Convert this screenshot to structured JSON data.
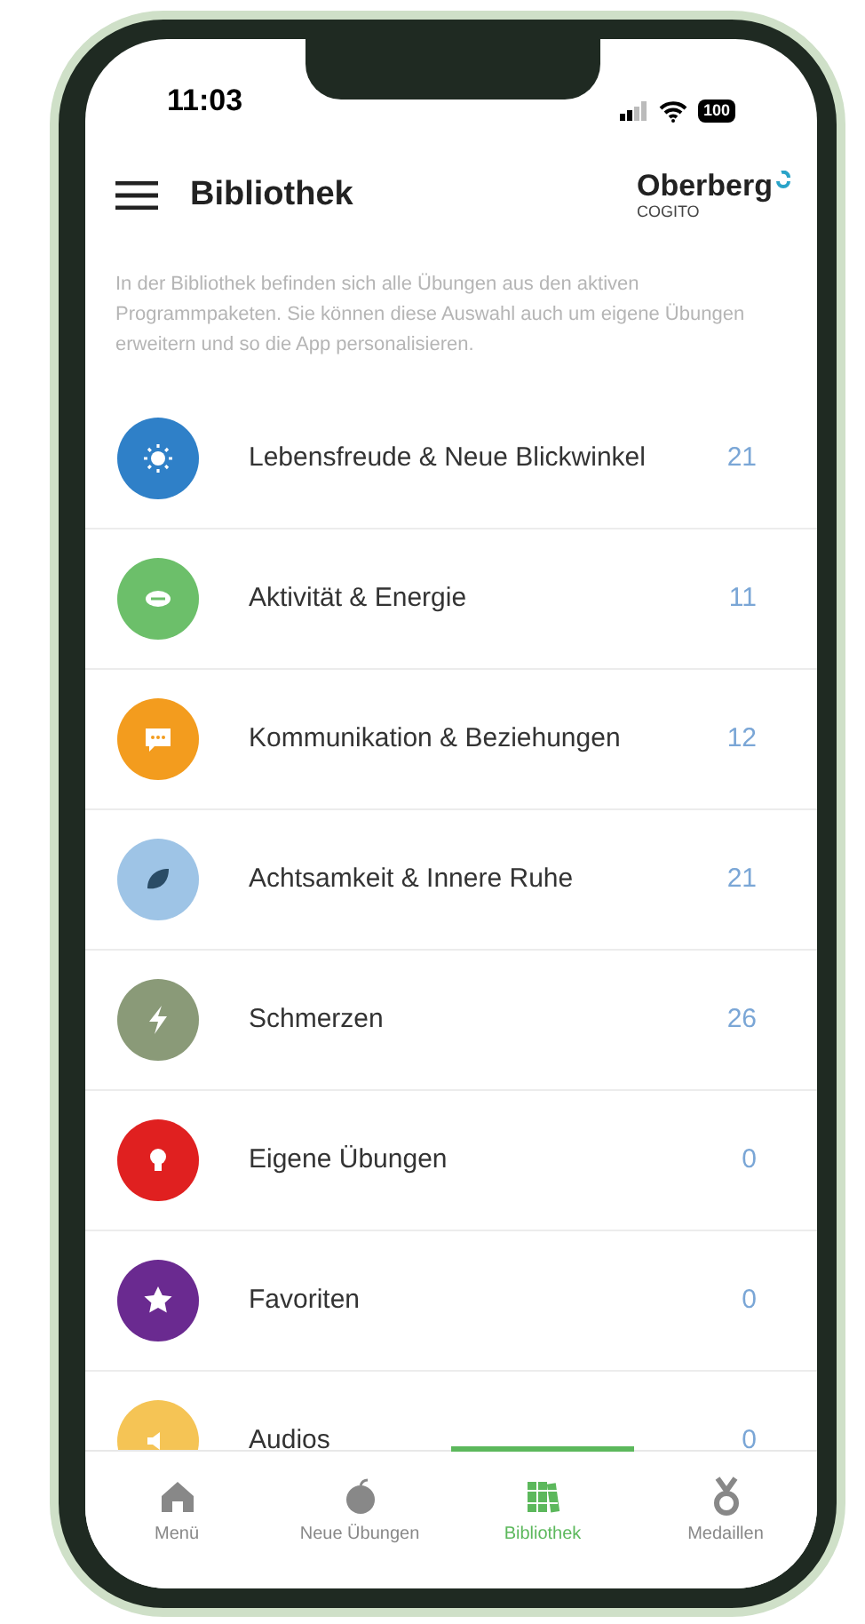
{
  "status_bar": {
    "time": "11:03",
    "battery": "100"
  },
  "header": {
    "title": "Bibliothek",
    "logo": "Oberberg",
    "logo_sub": "COGITO"
  },
  "intro": "In der Bibliothek befinden sich alle Übungen aus den aktiven Programmpaketen. Sie können diese Auswahl auch um eigene Übungen erweitern und so die App personalisieren.",
  "categories": [
    {
      "label": "Lebensfreude & Neue Blickwinkel",
      "count": "21",
      "color": "#2f80c8",
      "kind": "sun"
    },
    {
      "label": "Aktivität & Energie",
      "count": "11",
      "color": "#6cbf6a",
      "kind": "ball"
    },
    {
      "label": "Kommunikation & Beziehungen",
      "count": "12",
      "color": "#f39c1e",
      "kind": "chat"
    },
    {
      "label": "Achtsamkeit & Innere Ruhe",
      "count": "21",
      "color": "#9ec4e6",
      "kind": "leaf"
    },
    {
      "label": "Schmerzen",
      "count": "26",
      "color": "#8a9a78",
      "kind": "bolt"
    },
    {
      "label": "Eigene Übungen",
      "count": "0",
      "color": "#e02020",
      "kind": "bulb"
    },
    {
      "label": "Favoriten",
      "count": "0",
      "color": "#6a2a90",
      "kind": "star"
    },
    {
      "label": "Audios",
      "count": "0",
      "color": "#f5c455",
      "kind": "speaker"
    }
  ],
  "tabs": [
    {
      "label": "Menü",
      "kind": "home",
      "selected": false
    },
    {
      "label": "Neue Übungen",
      "kind": "apple",
      "selected": false
    },
    {
      "label": "Bibliothek",
      "kind": "books",
      "selected": true
    },
    {
      "label": "Medaillen",
      "kind": "medal",
      "selected": false
    }
  ]
}
